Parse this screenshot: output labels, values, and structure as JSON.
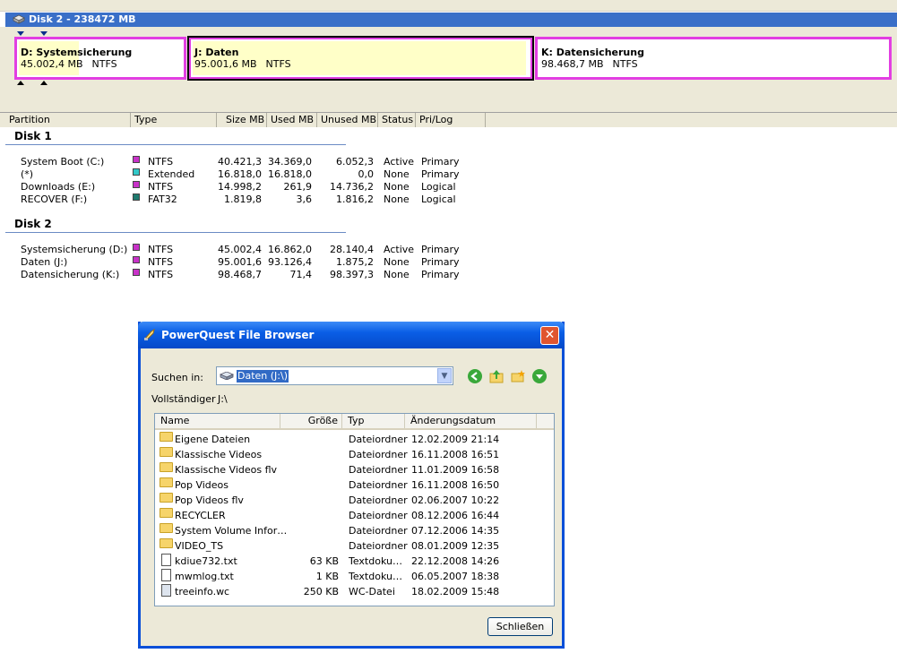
{
  "disk_bar": {
    "title": "Disk 2 - 238472 MB"
  },
  "partitions": [
    {
      "name": "D:  Systemsicherung",
      "size": "45.002,4 MB",
      "fs": "NTFS"
    },
    {
      "name": "J:  Daten",
      "size": "95.001,6 MB",
      "fs": "NTFS"
    },
    {
      "name": "K:  Datensicherung",
      "size": "98.468,7 MB",
      "fs": "NTFS"
    }
  ],
  "list": {
    "headers": [
      "Partition",
      "Type",
      "Size MB",
      "Used MB",
      "Unused MB",
      "Status",
      "Pri/Log"
    ],
    "groups": [
      {
        "title": "Disk 1",
        "rows": [
          {
            "partition": "System Boot (C:)",
            "color": "#c832c8",
            "type": "NTFS",
            "size": "40.421,3",
            "used": "34.369,0",
            "unused": "6.052,3",
            "status": "Active",
            "prilog": "Primary"
          },
          {
            "partition": "(*)",
            "color": "#32c8c8",
            "type": "Extended",
            "size": "16.818,0",
            "used": "16.818,0",
            "unused": "0,0",
            "status": "None",
            "prilog": "Primary"
          },
          {
            "partition": "Downloads (E:)",
            "color": "#c832c8",
            "type": "NTFS",
            "size": "14.998,2",
            "used": "261,9",
            "unused": "14.736,2",
            "status": "None",
            "prilog": "Logical"
          },
          {
            "partition": "RECOVER (F:)",
            "color": "#1e7a6e",
            "type": "FAT32",
            "size": "1.819,8",
            "used": "3,6",
            "unused": "1.816,2",
            "status": "None",
            "prilog": "Logical"
          }
        ]
      },
      {
        "title": "Disk 2",
        "rows": [
          {
            "partition": "Systemsicherung (D:)",
            "color": "#c832c8",
            "type": "NTFS",
            "size": "45.002,4",
            "used": "16.862,0",
            "unused": "28.140,4",
            "status": "Active",
            "prilog": "Primary"
          },
          {
            "partition": "Daten (J:)",
            "color": "#c832c8",
            "type": "NTFS",
            "size": "95.001,6",
            "used": "93.126,4",
            "unused": "1.875,2",
            "status": "None",
            "prilog": "Primary"
          },
          {
            "partition": "Datensicherung (K:)",
            "color": "#c832c8",
            "type": "NTFS",
            "size": "98.468,7",
            "used": "71,4",
            "unused": "98.397,3",
            "status": "None",
            "prilog": "Primary"
          }
        ]
      }
    ]
  },
  "dialog": {
    "title": "PowerQuest File Browser",
    "close_glyph": "✕",
    "lookin_label": "Suchen in:",
    "lookin_value": "Daten (J:\\)",
    "fullpath_label": "Vollständiger",
    "fullpath_value": "J:\\",
    "columns": [
      "Name",
      "Größe",
      "Typ",
      "Änderungsdatum"
    ],
    "files": [
      {
        "name": "Eigene Dateien",
        "size": "",
        "type": "Dateiordner",
        "date": "12.02.2009 21:14",
        "icon": "folder-icon"
      },
      {
        "name": "Klassische Videos",
        "size": "",
        "type": "Dateiordner",
        "date": "16.11.2008 16:51",
        "icon": "folder-icon"
      },
      {
        "name": "Klassische Videos flv",
        "size": "",
        "type": "Dateiordner",
        "date": "11.01.2009 16:58",
        "icon": "folder-icon"
      },
      {
        "name": "Pop Videos",
        "size": "",
        "type": "Dateiordner",
        "date": "16.11.2008 16:50",
        "icon": "folder-icon"
      },
      {
        "name": "Pop Videos flv",
        "size": "",
        "type": "Dateiordner",
        "date": "02.06.2007 10:22",
        "icon": "folder-icon"
      },
      {
        "name": "RECYCLER",
        "size": "",
        "type": "Dateiordner",
        "date": "08.12.2006 16:44",
        "icon": "folder-icon"
      },
      {
        "name": "System Volume Infor…",
        "size": "",
        "type": "Dateiordner",
        "date": "07.12.2006 14:35",
        "icon": "folder-icon"
      },
      {
        "name": "VIDEO_TS",
        "size": "",
        "type": "Dateiordner",
        "date": "08.01.2009 12:35",
        "icon": "folder-icon"
      },
      {
        "name": "kdiue732.txt",
        "size": "63 KB",
        "type": "Textdoku…",
        "date": "22.12.2008 14:26",
        "icon": "text-file-icon"
      },
      {
        "name": "mwmlog.txt",
        "size": "1 KB",
        "type": "Textdoku…",
        "date": "06.05.2007 18:38",
        "icon": "text-file-icon"
      },
      {
        "name": "treeinfo.wc",
        "size": "250 KB",
        "type": "WC-Datei",
        "date": "18.02.2009 15:48",
        "icon": "wc-file-icon"
      }
    ],
    "close_button": "Schließen"
  }
}
